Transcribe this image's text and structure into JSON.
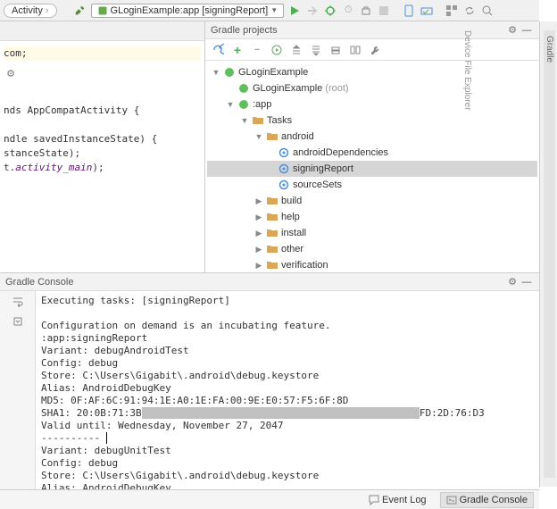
{
  "toolbar": {
    "breadcrumb_last": "Activity",
    "run_config": "GLoginExample:app [signingReport]"
  },
  "editor": {
    "line_com": "com;",
    "line_extends": "nds AppCompatActivity {",
    "line_method": "ndle savedInstanceState) {",
    "line_super": "stanceState);",
    "line_set1": "t.",
    "line_set2": "activity_main",
    "line_set3": ");"
  },
  "gradle_panel": {
    "title": "Gradle projects",
    "root": "GLoginExample",
    "root_sub": "GLoginExample",
    "root_sub_hint": "(root)",
    "app": ":app",
    "tasks": "Tasks",
    "folders": {
      "android": "android",
      "build": "build",
      "help": "help",
      "install": "install",
      "other": "other",
      "verification": "verification"
    },
    "android_tasks": {
      "dep": "androidDependencies",
      "signing": "signingReport",
      "source": "sourceSets"
    }
  },
  "console": {
    "title": "Gradle Console",
    "l1": "Executing tasks: [signingReport]",
    "l2": "",
    "l3": "Configuration on demand is an incubating feature.",
    "l4": ":app:signingReport",
    "l5": "Variant: debugAndroidTest",
    "l6": "Config: debug",
    "l7": "Store: C:\\Users\\Gigabit\\.android\\debug.keystore",
    "l8": "Alias: AndroidDebugKey",
    "l9": "MD5: 0F:AF:6C:91:94:1E:A0:1E:FA:00:9E:E0:57:F5:6F:8D",
    "l10a": "SHA1: 20:0B:71:3B",
    "l10b": "FD:2D:76:D3",
    "l11": "Valid until: Wednesday, November 27, 2047",
    "l12": "----------",
    "l13": "Variant: debugUnitTest",
    "l14": "Config: debug",
    "l15": "Store: C:\\Users\\Gigabit\\.android\\debug.keystore",
    "l16": "Alias: AndroidDebugKey"
  },
  "statusbar": {
    "event_log": "Event Log",
    "gradle_console": "Gradle Console"
  },
  "right_rail": {
    "gradle": "Gradle",
    "device": "Device File Explorer"
  }
}
